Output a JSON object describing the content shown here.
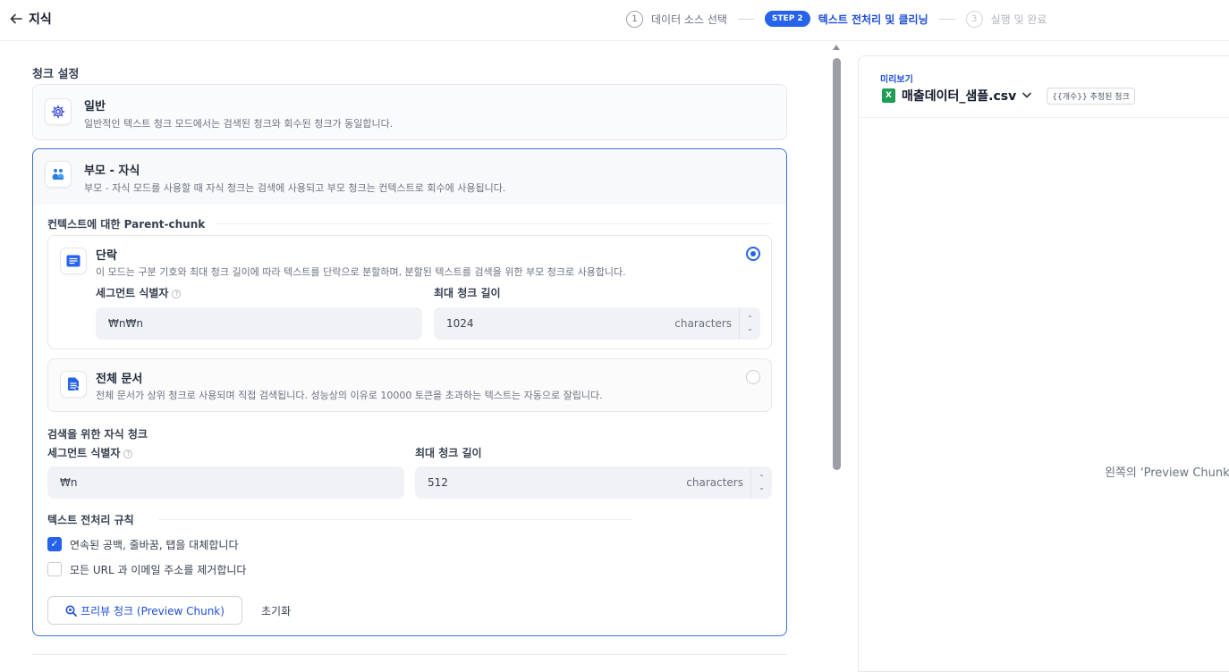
{
  "header": {
    "title": "지식",
    "steps": [
      {
        "num": "1",
        "label": "데이터 소스 선택"
      },
      {
        "pill": "STEP 2",
        "label": "텍스트 전처리 및 클리닝"
      },
      {
        "num": "3",
        "label": "실행 및 완료"
      }
    ]
  },
  "chunk_settings": {
    "title": "청크 설정",
    "general": {
      "title": "일반",
      "description": "일반적인 텍스트 청크 모드에서는 검색된 청크와 회수된 청크가 동일합니다."
    },
    "parent_child": {
      "title": "부모 - 자식",
      "description": "부모 - 자식 모드를 사용할 때 자식 청크는 검색에 사용되고 부모 청크는 컨텍스트로 회수에 사용됩니다.",
      "parent_heading": "컨텍스트에 대한 Parent-chunk",
      "paragraph": {
        "title": "단락",
        "description": "이 모드는 구분 기호와 최대 청크 길이에 따라 텍스트를 단락으로 분할하며, 분할된 텍스트를 검색을 위한 부모 청크로 사용합니다.",
        "segment_label": "세그먼트 식별자",
        "segment_value": "₩n₩n",
        "max_label": "최대 청크 길이",
        "max_value": "1024",
        "unit": "characters",
        "selected": true
      },
      "full_doc": {
        "title": "전체 문서",
        "description": "전체 문서가 상위 청크로 사용되며 직접 검색됩니다. 성능상의 이유로 10000 토큰을 초과하는 텍스트는 자동으로 잘립니다.",
        "selected": false
      },
      "child_heading": "검색을 위한 자식 청크",
      "child": {
        "segment_label": "세그먼트 식별자",
        "segment_value": "₩n",
        "max_label": "최대 청크 길이",
        "max_value": "512",
        "unit": "characters"
      },
      "rules_heading": "텍스트 전처리 규칙",
      "rules": [
        {
          "label": "연속된 공백, 줄바꿈, 탭을 대체합니다",
          "checked": true
        },
        {
          "label": "모든 URL 과 이메일 주소를 제거합니다",
          "checked": false
        }
      ],
      "preview_button": "프리뷰 청크 (Preview Chunk)",
      "reset_button": "초기화"
    }
  },
  "preview": {
    "caption": "미리보기",
    "file_icon": "X",
    "file_name": "매출데이터_샘플.csv",
    "badge": "{{개수}} 추정된 청크",
    "empty_text": "왼쪽의 'Preview Chunk"
  },
  "colors": {
    "accent": "#2563eb",
    "file_green": "#1f9d55"
  }
}
